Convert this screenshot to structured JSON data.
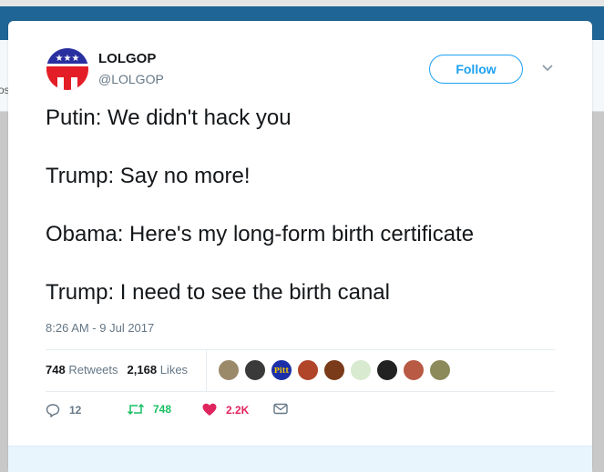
{
  "background": {
    "nav_color": "#1f6596",
    "partial_text": "os"
  },
  "tweet": {
    "author_name": "LOLGOP",
    "author_handle": "@LOLGOP",
    "follow_label": "Follow",
    "text_lines": [
      "Putin: We didn't hack you",
      "Trump: Say no more!",
      "Obama: Here's my long-form birth certificate",
      "Trump: I need to see the birth canal"
    ],
    "timestamp": "8:26 AM - 9 Jul 2017",
    "retweets_count": "748",
    "retweets_label": "Retweets",
    "likes_count": "2,168",
    "likes_label": "Likes",
    "liker_avatars": [
      {
        "name": "liker-1",
        "color": "#9a8a6a"
      },
      {
        "name": "liker-2",
        "color": "#3a3a3a"
      },
      {
        "name": "liker-3",
        "color": "#1b2fa8",
        "text": "Pitt"
      },
      {
        "name": "liker-4",
        "color": "#b0452a"
      },
      {
        "name": "liker-5",
        "color": "#7a3b1a"
      },
      {
        "name": "liker-6",
        "color": "#d8ead0"
      },
      {
        "name": "liker-7",
        "color": "#222222"
      },
      {
        "name": "liker-8",
        "color": "#b85a44"
      },
      {
        "name": "liker-9",
        "color": "#8c8a5a"
      }
    ],
    "actions": {
      "reply_count": "12",
      "retweet_count": "748",
      "like_count": "2.2K"
    },
    "colors": {
      "accent": "#1da1f2",
      "retweet": "#17bf63",
      "like": "#e0245e",
      "muted": "#657786"
    }
  }
}
